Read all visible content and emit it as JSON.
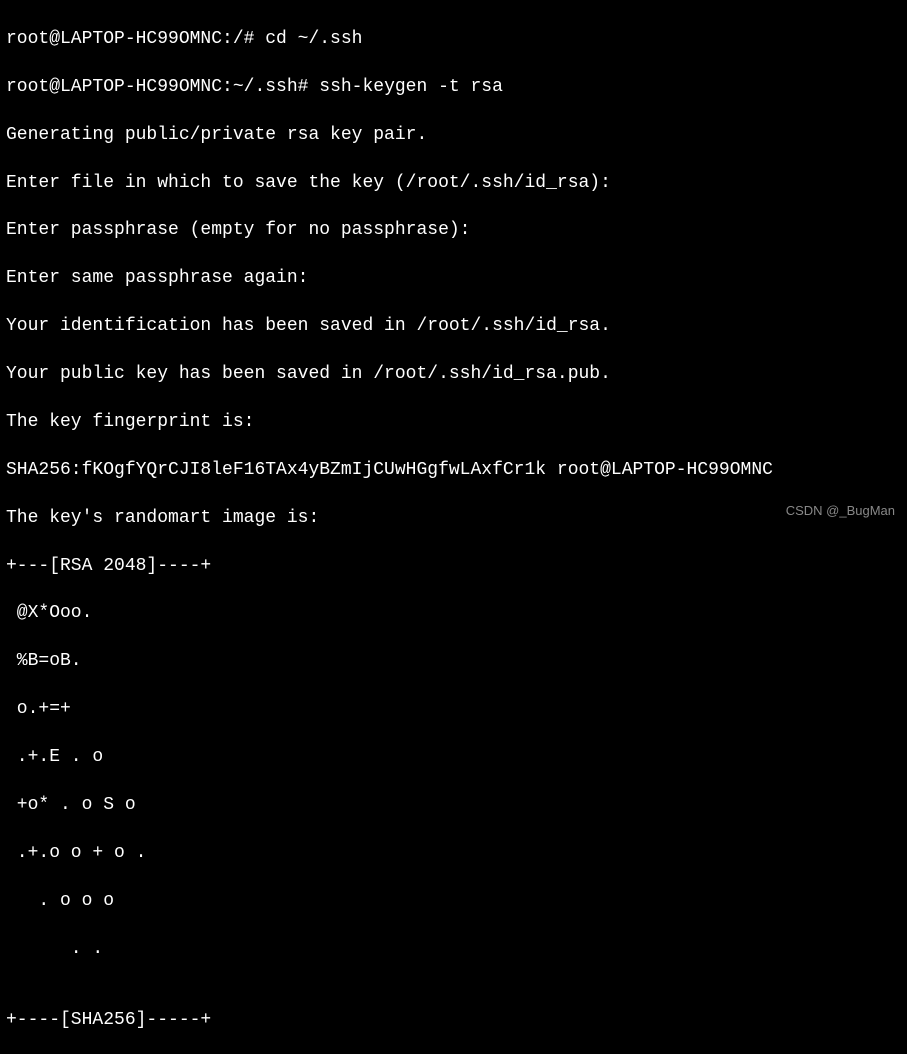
{
  "terminal": {
    "line1_prompt": "root@LAPTOP-HC99OMNC:/# ",
    "line1_cmd": "cd ~/.ssh",
    "line2_prompt": "root@LAPTOP-HC99OMNC:~/.ssh# ",
    "line2_cmd": "ssh-keygen -t rsa",
    "line3": "Generating public/private rsa key pair.",
    "line4": "Enter file in which to save the key (/root/.ssh/id_rsa):",
    "line5": "Enter passphrase (empty for no passphrase):",
    "line6": "Enter same passphrase again:",
    "line7": "Your identification has been saved in /root/.ssh/id_rsa.",
    "line8": "Your public key has been saved in /root/.ssh/id_rsa.pub.",
    "line9": "The key fingerprint is:",
    "line10": "SHA256:fKOgfYQrCJI8leF16TAx4yBZmIjCUwHGgfwLAxfCr1k root@LAPTOP-HC99OMNC",
    "line11": "The key's randomart image is:",
    "art1": "+---[RSA 2048]----+",
    "art2": " @X*Ooo.",
    "art3": " %B=oB.",
    "art4": " o.+=+",
    "art5": " .+.E . o",
    "art6": " +o* . o S o",
    "art7": " .+.o o + o .",
    "art8": "   . o o o",
    "art9": "      . .",
    "art10": "",
    "art11": "+----[SHA256]-----+"
  },
  "watermark": "CSDN @_BugMan"
}
